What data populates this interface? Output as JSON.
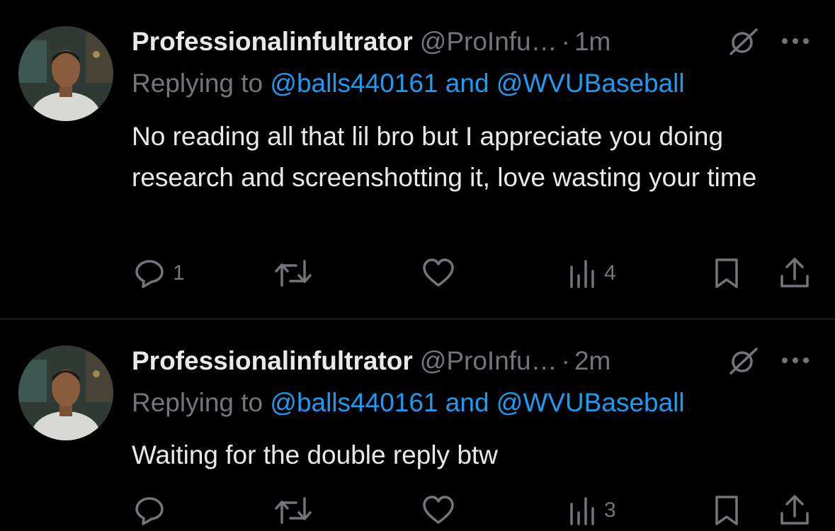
{
  "tweets": [
    {
      "display_name": "Professionalinfultrator",
      "handle": "@ProInfu…",
      "separator": "·",
      "time": "1m",
      "replying_prefix": "Replying to",
      "replying_to": "@balls440161 and @WVUBaseball",
      "text": "No reading all that lil bro but I appreciate you doing research and screenshotting it, love wasting your time",
      "reply_count": "1",
      "retweet_count": "",
      "like_count": "",
      "view_count": "4"
    },
    {
      "display_name": "Professionalinfultrator",
      "handle": "@ProInfu…",
      "separator": "·",
      "time": "2m",
      "replying_prefix": "Replying to",
      "replying_to": "@balls440161 and @WVUBaseball",
      "text": "Waiting for the double reply btw",
      "reply_count": "",
      "retweet_count": "",
      "like_count": "",
      "view_count": "3"
    }
  ],
  "icons": {
    "grok": "grok-icon",
    "more": "more-icon",
    "reply": "reply-icon",
    "retweet": "retweet-icon",
    "like": "like-icon",
    "views": "views-icon",
    "bookmark": "bookmark-icon",
    "share": "share-icon"
  },
  "colors": {
    "background": "#000000",
    "text_primary": "#e7e9ea",
    "text_secondary": "#71767b",
    "accent": "#1d9bf0",
    "divider": "#2f3336"
  }
}
